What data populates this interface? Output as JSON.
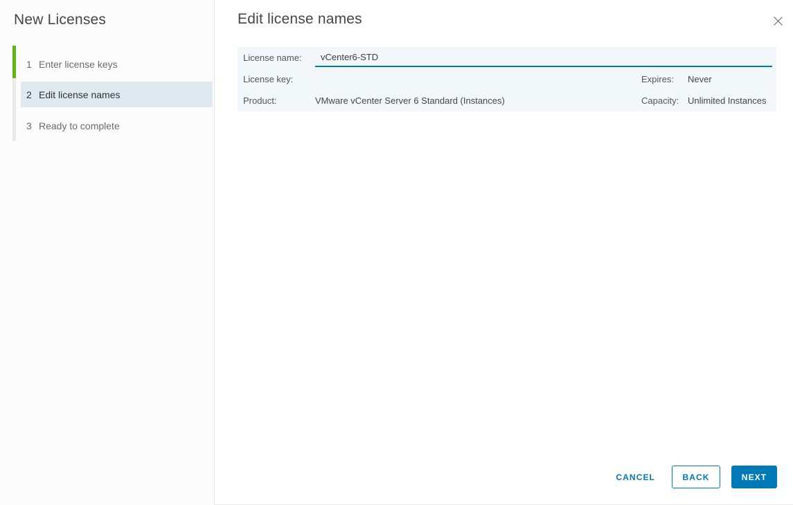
{
  "sidebar": {
    "title": "New Licenses",
    "steps": [
      {
        "number": "1",
        "label": "Enter license keys",
        "state": "completed"
      },
      {
        "number": "2",
        "label": "Edit license names",
        "state": "current"
      },
      {
        "number": "3",
        "label": "Ready to complete",
        "state": "upcoming"
      }
    ]
  },
  "header": {
    "title": "Edit license names",
    "close_icon": "close-icon"
  },
  "license_form": {
    "license_name_label": "License name:",
    "license_name_value": "vCenter6-STD",
    "license_key_label": "License key:",
    "license_key_redacted": true,
    "expires_label": "Expires:",
    "expires_value": "Never",
    "product_label": "Product:",
    "product_value": "VMware vCenter Server 6 Standard (Instances)",
    "capacity_label": "Capacity:",
    "capacity_value": "Unlimited Instances"
  },
  "footer": {
    "cancel_label": "CANCEL",
    "back_label": "BACK",
    "next_label": "NEXT"
  },
  "colors": {
    "primary_blue": "#0079b8",
    "step_complete_green": "#61b515",
    "active_step_bg": "#dfe9f0",
    "panel_bg": "#f2f7fa"
  }
}
